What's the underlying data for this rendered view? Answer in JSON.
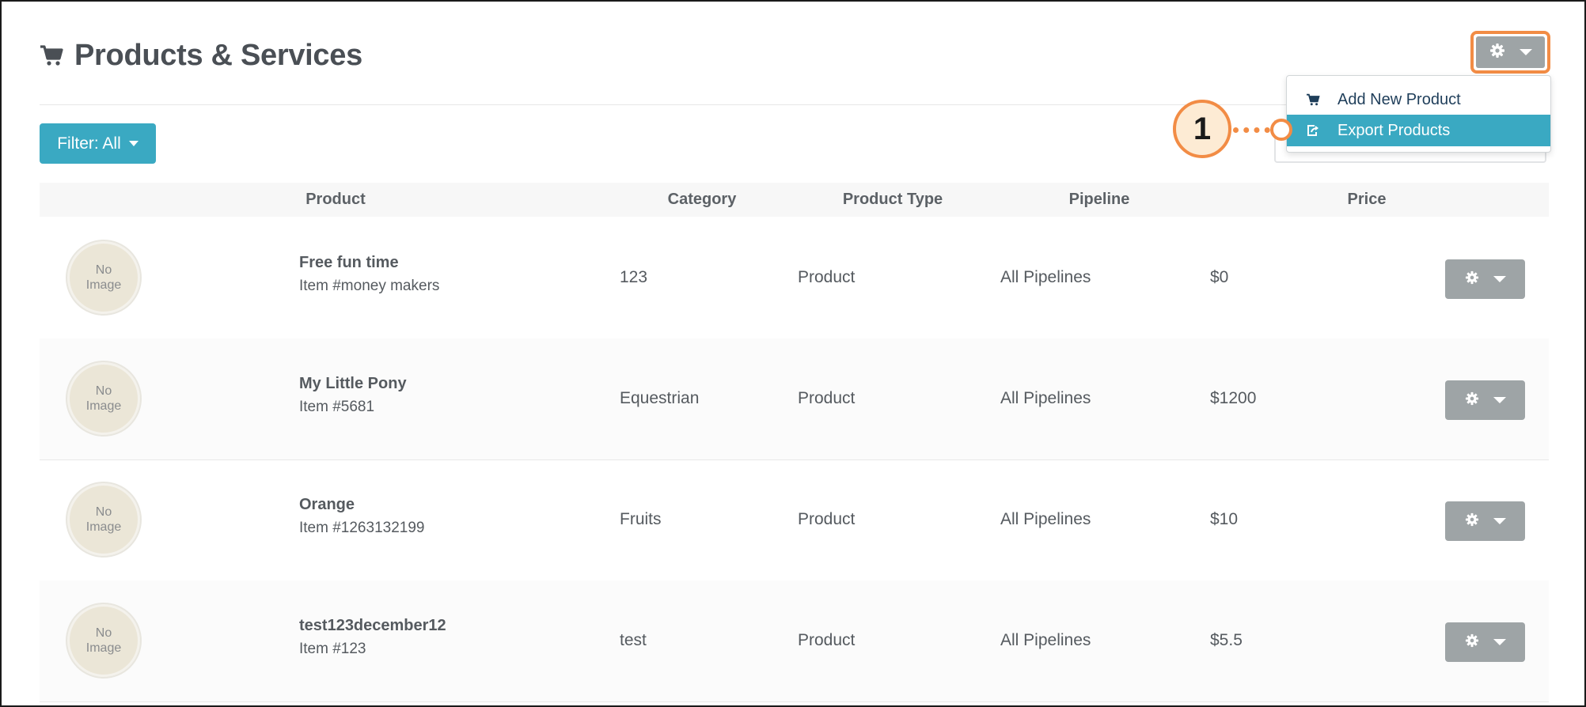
{
  "header": {
    "title": "Products & Services"
  },
  "dropdown": {
    "items": [
      {
        "label": "Add New Product",
        "icon": "cart-icon"
      },
      {
        "label": "Export Products",
        "icon": "export-icon",
        "highlighted": true
      }
    ]
  },
  "callout": {
    "number": "1"
  },
  "filter": {
    "label": "Filter: All"
  },
  "table": {
    "headers": {
      "product": "Product",
      "category": "Category",
      "type": "Product Type",
      "pipeline": "Pipeline",
      "price": "Price"
    },
    "rows": [
      {
        "image": "No Image",
        "name": "Free fun time",
        "item": "Item #money makers",
        "category": "123",
        "type": "Product",
        "pipeline": "All Pipelines",
        "price": "$0"
      },
      {
        "image": "No Image",
        "name": "My Little Pony",
        "item": "Item #5681",
        "category": "Equestrian",
        "type": "Product",
        "pipeline": "All Pipelines",
        "price": "$1200"
      },
      {
        "image": "No Image",
        "name": "Orange",
        "item": "Item #1263132199",
        "category": "Fruits",
        "type": "Product",
        "pipeline": "All Pipelines",
        "price": "$10"
      },
      {
        "image": "No Image",
        "name": "test123december12",
        "item": "Item #123",
        "category": "test",
        "type": "Product",
        "pipeline": "All Pipelines",
        "price": "$5.5"
      }
    ]
  },
  "colors": {
    "accent": "#3aa9c2",
    "highlight": "#f28c45",
    "gear_button": "#9ea4a6"
  }
}
